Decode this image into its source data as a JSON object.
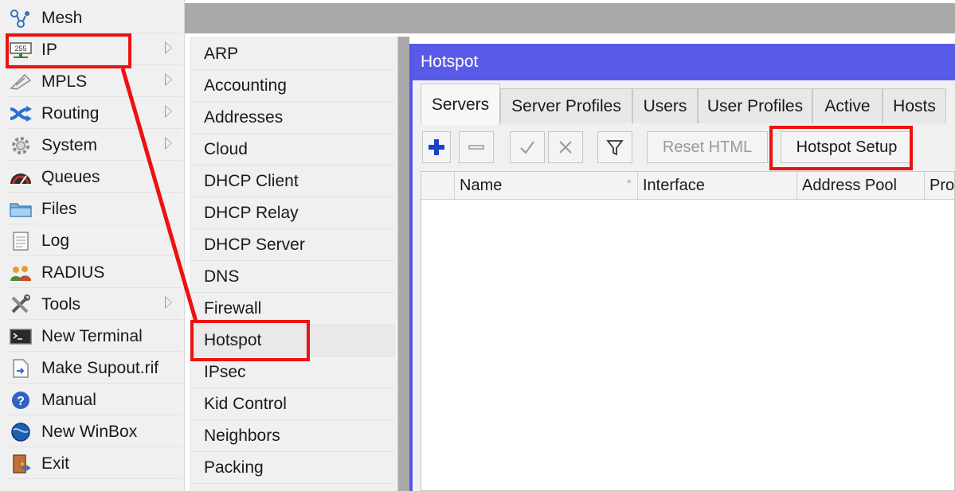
{
  "main_menu": {
    "items": [
      {
        "label": "Mesh",
        "icon": "mesh-icon",
        "has_submenu": false
      },
      {
        "label": "IP",
        "icon": "ip-icon",
        "has_submenu": true
      },
      {
        "label": "MPLS",
        "icon": "mpls-icon",
        "has_submenu": true
      },
      {
        "label": "Routing",
        "icon": "routing-icon",
        "has_submenu": true
      },
      {
        "label": "System",
        "icon": "system-gear-icon",
        "has_submenu": true
      },
      {
        "label": "Queues",
        "icon": "queues-icon",
        "has_submenu": false
      },
      {
        "label": "Files",
        "icon": "folder-icon",
        "has_submenu": false
      },
      {
        "label": "Log",
        "icon": "log-icon",
        "has_submenu": false
      },
      {
        "label": "RADIUS",
        "icon": "radius-users-icon",
        "has_submenu": false
      },
      {
        "label": "Tools",
        "icon": "tools-icon",
        "has_submenu": true
      },
      {
        "label": "New Terminal",
        "icon": "terminal-icon",
        "has_submenu": false
      },
      {
        "label": "Make Supout.rif",
        "icon": "supout-file-icon",
        "has_submenu": false
      },
      {
        "label": "Manual",
        "icon": "help-icon",
        "has_submenu": false
      },
      {
        "label": "New WinBox",
        "icon": "winbox-globe-icon",
        "has_submenu": false
      },
      {
        "label": "Exit",
        "icon": "exit-door-icon",
        "has_submenu": false
      }
    ]
  },
  "ip_submenu": {
    "items": [
      "ARP",
      "Accounting",
      "Addresses",
      "Cloud",
      "DHCP Client",
      "DHCP Relay",
      "DHCP Server",
      "DNS",
      "Firewall",
      "Hotspot",
      "IPsec",
      "Kid Control",
      "Neighbors",
      "Packing"
    ],
    "selected": "Hotspot"
  },
  "hotspot_window": {
    "title": "Hotspot",
    "tabs": [
      "Servers",
      "Server Profiles",
      "Users",
      "User Profiles",
      "Active",
      "Hosts"
    ],
    "active_tab": "Servers",
    "toolbar": {
      "reset_html_label": "Reset HTML",
      "hotspot_setup_label": "Hotspot Setup"
    },
    "table": {
      "columns": [
        "Name",
        "Interface",
        "Address Pool",
        "Pro"
      ]
    }
  },
  "colors": {
    "title_bar": "#5a5ae8",
    "highlight": "#ee1111",
    "menu_bg": "#f0f0f0",
    "desktop": "#a9a9a9"
  }
}
